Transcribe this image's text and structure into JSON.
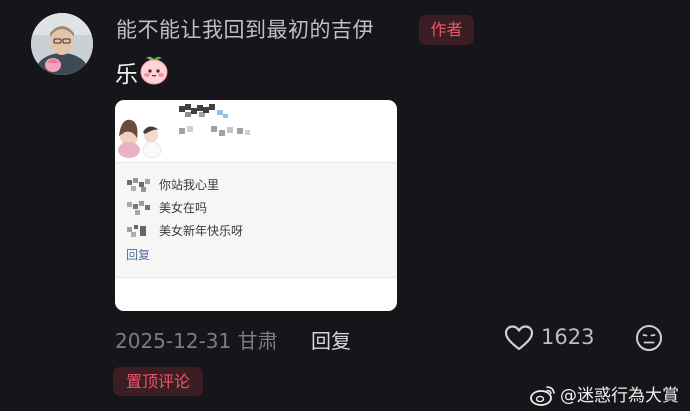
{
  "comment": {
    "author_name": "能不能让我回到最初的吉伊",
    "author_badge": "作者",
    "text": "乐",
    "emoji_icon": "peach-blush-emoji-icon",
    "date_location": "2025-12-31 甘肃",
    "reply_label": "回复",
    "like_count": "1623",
    "pinned_label": "置顶评论"
  },
  "embedded_card": {
    "replies": [
      {
        "text": "你站我心里"
      },
      {
        "text": "美女在吗"
      },
      {
        "text": "美女新年快乐呀"
      }
    ],
    "reply_link": "回复"
  },
  "watermark": {
    "icon": "weibo-icon",
    "text": "@迷惑行為大賞"
  },
  "colors": {
    "background": "#161519",
    "badge_bg": "#3a1e23",
    "badge_text": "#f0546b",
    "muted_text": "#7c7c82"
  }
}
